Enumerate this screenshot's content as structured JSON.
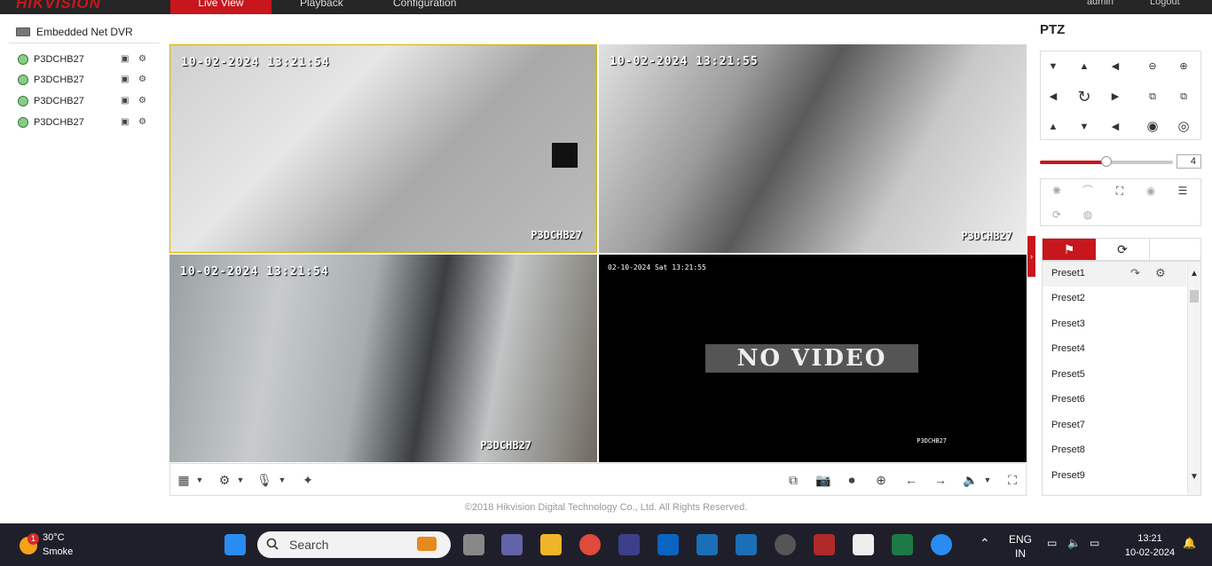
{
  "nav": {
    "brand": "HIKVISION",
    "tabs": [
      "Live View",
      "Playback",
      "Configuration"
    ],
    "user": "admin",
    "logout": "Logout"
  },
  "tree": {
    "root": "Embedded Net DVR",
    "cameras": [
      {
        "name": "P3DCHB27"
      },
      {
        "name": "P3DCHB27"
      },
      {
        "name": "P3DCHB27"
      },
      {
        "name": "P3DCHB27"
      }
    ]
  },
  "tiles": [
    {
      "time": "10-02-2024 13:21:54",
      "name": "P3DCHB27"
    },
    {
      "time": "10-02-2024 13:21:55",
      "name": "P3DCHB27"
    },
    {
      "time": "10-02-2024 13:21:54",
      "name": "P3DCHB27"
    },
    {
      "time": "02-10-2024 Sat 13:21:55",
      "name": "P3DCHB27",
      "message": "NO VIDEO"
    }
  ],
  "footer": "©2018 Hikvision Digital Technology Co., Ltd. All Rights Reserved.",
  "ptz": {
    "title": "PTZ",
    "speed": "4",
    "speed_fraction": 0.5,
    "presets": [
      "Preset1",
      "Preset2",
      "Preset3",
      "Preset4",
      "Preset5",
      "Preset6",
      "Preset7",
      "Preset8",
      "Preset9"
    ]
  },
  "taskbar": {
    "temp": "30°C",
    "weather": "Smoke",
    "notify_count": "1",
    "search": "Search",
    "lang1": "ENG",
    "lang2": "IN",
    "time": "13:21",
    "date": "10-02-2024"
  },
  "colors": {
    "accent": "#c8161d",
    "selected_border": "#d9b300"
  }
}
